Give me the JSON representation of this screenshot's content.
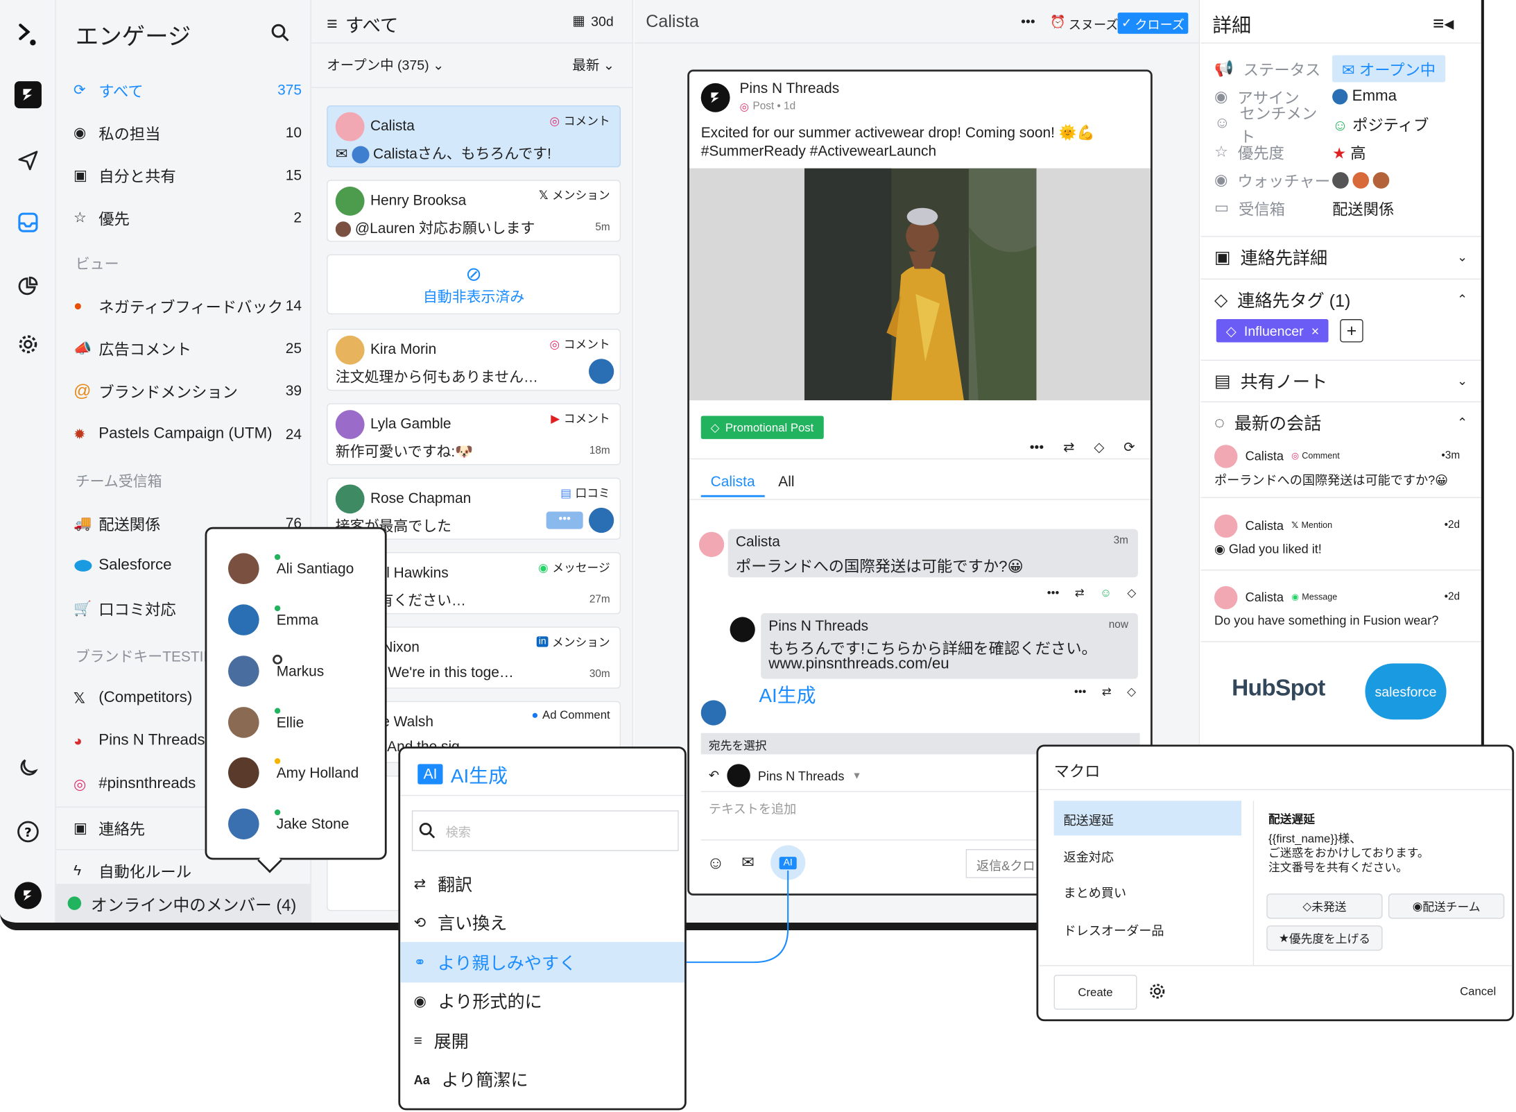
{
  "colors": {
    "accent": "#1a8cff",
    "selected": "#d4e8fb",
    "green": "#22b35e",
    "tag_purple": "#6b5cf6",
    "ai_highlight": "#d4e8fb"
  },
  "rail": {
    "icons": [
      "logo-icon",
      "brand-icon",
      "send-icon",
      "inbox-icon",
      "pie-chart-icon",
      "settings-icon",
      "moon-icon",
      "help-icon",
      "account-icon"
    ]
  },
  "left": {
    "title": "エンゲージ",
    "items": [
      {
        "label": "すべて",
        "count": "375",
        "icon": "engage-icon"
      },
      {
        "label": "私の担当",
        "count": "10",
        "icon": "user-circle-icon"
      },
      {
        "label": "自分と共有",
        "count": "15",
        "icon": "shared-icon"
      },
      {
        "label": "優先",
        "count": "2",
        "icon": "star-icon"
      }
    ],
    "views_header": "ビュー",
    "views": [
      {
        "label": "ネガティブフィードバック",
        "count": "14",
        "icon": "angry-face-icon"
      },
      {
        "label": "広告コメント",
        "count": "25",
        "icon": "megaphone-icon"
      },
      {
        "label": "ブランドメンション",
        "count": "39",
        "icon": "at-icon"
      },
      {
        "label": "Pastels Campaign (UTM)",
        "count": "24",
        "icon": "leaf-icon"
      }
    ],
    "team_header": "チーム受信箱",
    "team": [
      {
        "label": "配送関係",
        "count": "76",
        "icon": "truck-icon"
      },
      {
        "label": "Salesforce",
        "count": "",
        "icon": "salesforce-icon"
      },
      {
        "label": "口コミ対応",
        "count": "",
        "icon": "cart-icon"
      }
    ],
    "brand_header": "ブランドキーTESTIN",
    "brand": [
      {
        "label": "(Competitors)",
        "icon": "x-logo-icon"
      },
      {
        "label": "Pins N Threads",
        "icon": "pinterest-icon"
      },
      {
        "label": "#pinsnthreads",
        "icon": "instagram-icon"
      }
    ],
    "contacts": "連絡先",
    "automation": "自動化ルール",
    "online": "オンライン中のメンバー (4)"
  },
  "members": [
    "Ali Santiago",
    "Emma",
    "Markus",
    "Ellie",
    "Amy Holland",
    "Jake Stone"
  ],
  "list": {
    "header": "すべて",
    "range": "30d",
    "filter": "オープン中 (375)",
    "sort": "最新",
    "hidden_label": "自動非表示済み",
    "cards": [
      {
        "name": "Calista",
        "tag": "コメント",
        "msg": "Calistaさん、もちろんです!",
        "time": ""
      },
      {
        "name": "Henry Brooksa",
        "tag": "メンション",
        "msg": "@Lauren 対応お願いします",
        "time": "5m"
      },
      {
        "name": "Kira Morin",
        "tag": "コメント",
        "msg": "注文処理から何もありません…",
        "time": ""
      },
      {
        "name": "Lyla Gamble",
        "tag": "コメント",
        "msg": "新作可愛いですね:🐶",
        "time": "18m"
      },
      {
        "name": "Rose Chapman",
        "tag": "口コミ",
        "msg": "接客が最高でした",
        "time": ""
      },
      {
        "name": "bel Hawkins",
        "tag": "メッセージ",
        "msg": "号を共有ください…",
        "time": "27m"
      },
      {
        "name": "n Nixon",
        "tag": "メンション",
        "msg": "threads We're in this toge…",
        "time": "30m"
      },
      {
        "name": "die Walsh",
        "tag": "Ad Comment",
        "msg": "threads And the sig",
        "time": ""
      }
    ]
  },
  "conv": {
    "title": "Calista",
    "snooze": "スヌーズ",
    "close": "クローズ",
    "post_author": "Pins N Threads",
    "post_meta": "Post • 1d",
    "post_text": "Excited for our summer activewear drop! Coming soon! 🌞💪 #SummerReady #ActivewearLaunch",
    "promo": "Promotional Post",
    "tab1": "Calista",
    "tab2": "All",
    "msg1_name": "Calista",
    "msg1_time": "3m",
    "msg1_text": "ポーランドへの国際発送は可能ですか?😀",
    "msg2_name": "Pins N Threads",
    "msg2_time": "now",
    "msg2_text": "もちろんです!こちらから詳細を確認ください。",
    "msg2_link": "www.pinsnthreads.com/eu",
    "ai_label": "AI生成",
    "to_label": "宛先を選択",
    "to_account": "Pins N Threads",
    "compose_placeholder": "テキストを追加",
    "reply_btn": "返信&クロ",
    "ai_btn": "AI"
  },
  "ai_menu": {
    "badge": "AI",
    "title": "AI生成",
    "search_placeholder": "検索",
    "items": [
      {
        "label": "翻訳",
        "icon": "translate-icon"
      },
      {
        "label": "言い換え",
        "icon": "rephrase-icon"
      },
      {
        "label": "より親しみやすく",
        "icon": "handshake-icon"
      },
      {
        "label": "より形式的に",
        "icon": "formal-icon"
      },
      {
        "label": "展開",
        "icon": "expand-icon"
      },
      {
        "label": "より簡潔に",
        "icon": "shorten-icon"
      }
    ],
    "shorten_glyph": "Aa"
  },
  "details": {
    "title": "詳細",
    "rows": [
      {
        "label": "ステータス",
        "value": "オープン中",
        "icon": "megaphone-icon"
      },
      {
        "label": "アサイン",
        "value": "Emma",
        "icon": "user-circle-icon"
      },
      {
        "label": "センチメント",
        "value": "ポジティブ",
        "icon": "smile-icon"
      },
      {
        "label": "優先度",
        "value": "高",
        "icon": "star-icon"
      },
      {
        "label": "ウォッチャー",
        "value": "",
        "icon": "eye-icon"
      },
      {
        "label": "受信箱",
        "value": "配送関係",
        "icon": "inbox-icon"
      }
    ],
    "contact_details": "連絡先詳細",
    "contact_tags": "連絡先タグ (1)",
    "tag": "Influencer",
    "shared_notes": "共有ノート",
    "recent": "最新の会話",
    "recent_items": [
      {
        "name": "Calista",
        "type": "Comment",
        "time": "3m",
        "text": "ポーランドへの国際発送は可能ですか?😀"
      },
      {
        "name": "Calista",
        "type": "Mention",
        "time": "2d",
        "text": "Glad you liked it!"
      },
      {
        "name": "Calista",
        "type": "Message",
        "time": "2d",
        "text": "Do you have something in Fusion wear?"
      }
    ],
    "hubspot": "HubSpot",
    "salesforce": "salesforce"
  },
  "macro": {
    "title": "マクロ",
    "items": [
      "配送遅延",
      "返金対応",
      "まとめ買い",
      "ドレスオーダー品"
    ],
    "preview_title": "配送遅延",
    "preview_text": "{{first_name}}様、\nご迷惑をおかけしております。\n注文番号を共有ください。",
    "actions": [
      "未発送",
      "配送チーム",
      "優先度を上げる"
    ],
    "create": "Create",
    "cancel": "Cancel"
  }
}
